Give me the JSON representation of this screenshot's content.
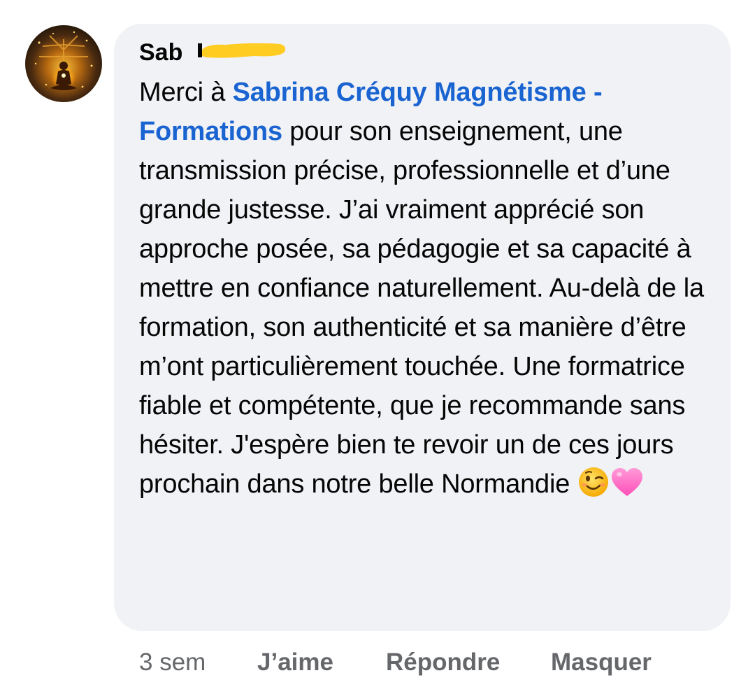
{
  "comment": {
    "author": "Sab",
    "text": {
      "intro": "Merci à ",
      "mention": "Sabrina Créquy Magnétisme - Formations",
      "body": "  pour son enseignement, une transmission précise, professionnelle et d’une grande justesse. J’ai vraiment apprécié son approche posée, sa pédagogie et sa capacité à mettre en confiance naturellement. Au-delà de la formation, son authenticité et sa manière d’être m’ont particulièrement touchée. Une formatrice fiable et compétente, que je recommande sans hésiter. J'espère bien te revoir un de ces jours prochain dans notre belle Normandie "
    },
    "emojis": [
      "winking-face",
      "pink-heart"
    ]
  },
  "actions": {
    "time": "3 sem",
    "like": "J’aime",
    "reply": "Répondre",
    "hide": "Masquer"
  },
  "colors": {
    "bubble": "#f0f2f5",
    "mention": "#1a64d2",
    "meta": "#65676b",
    "redaction": "#ffcc22"
  }
}
